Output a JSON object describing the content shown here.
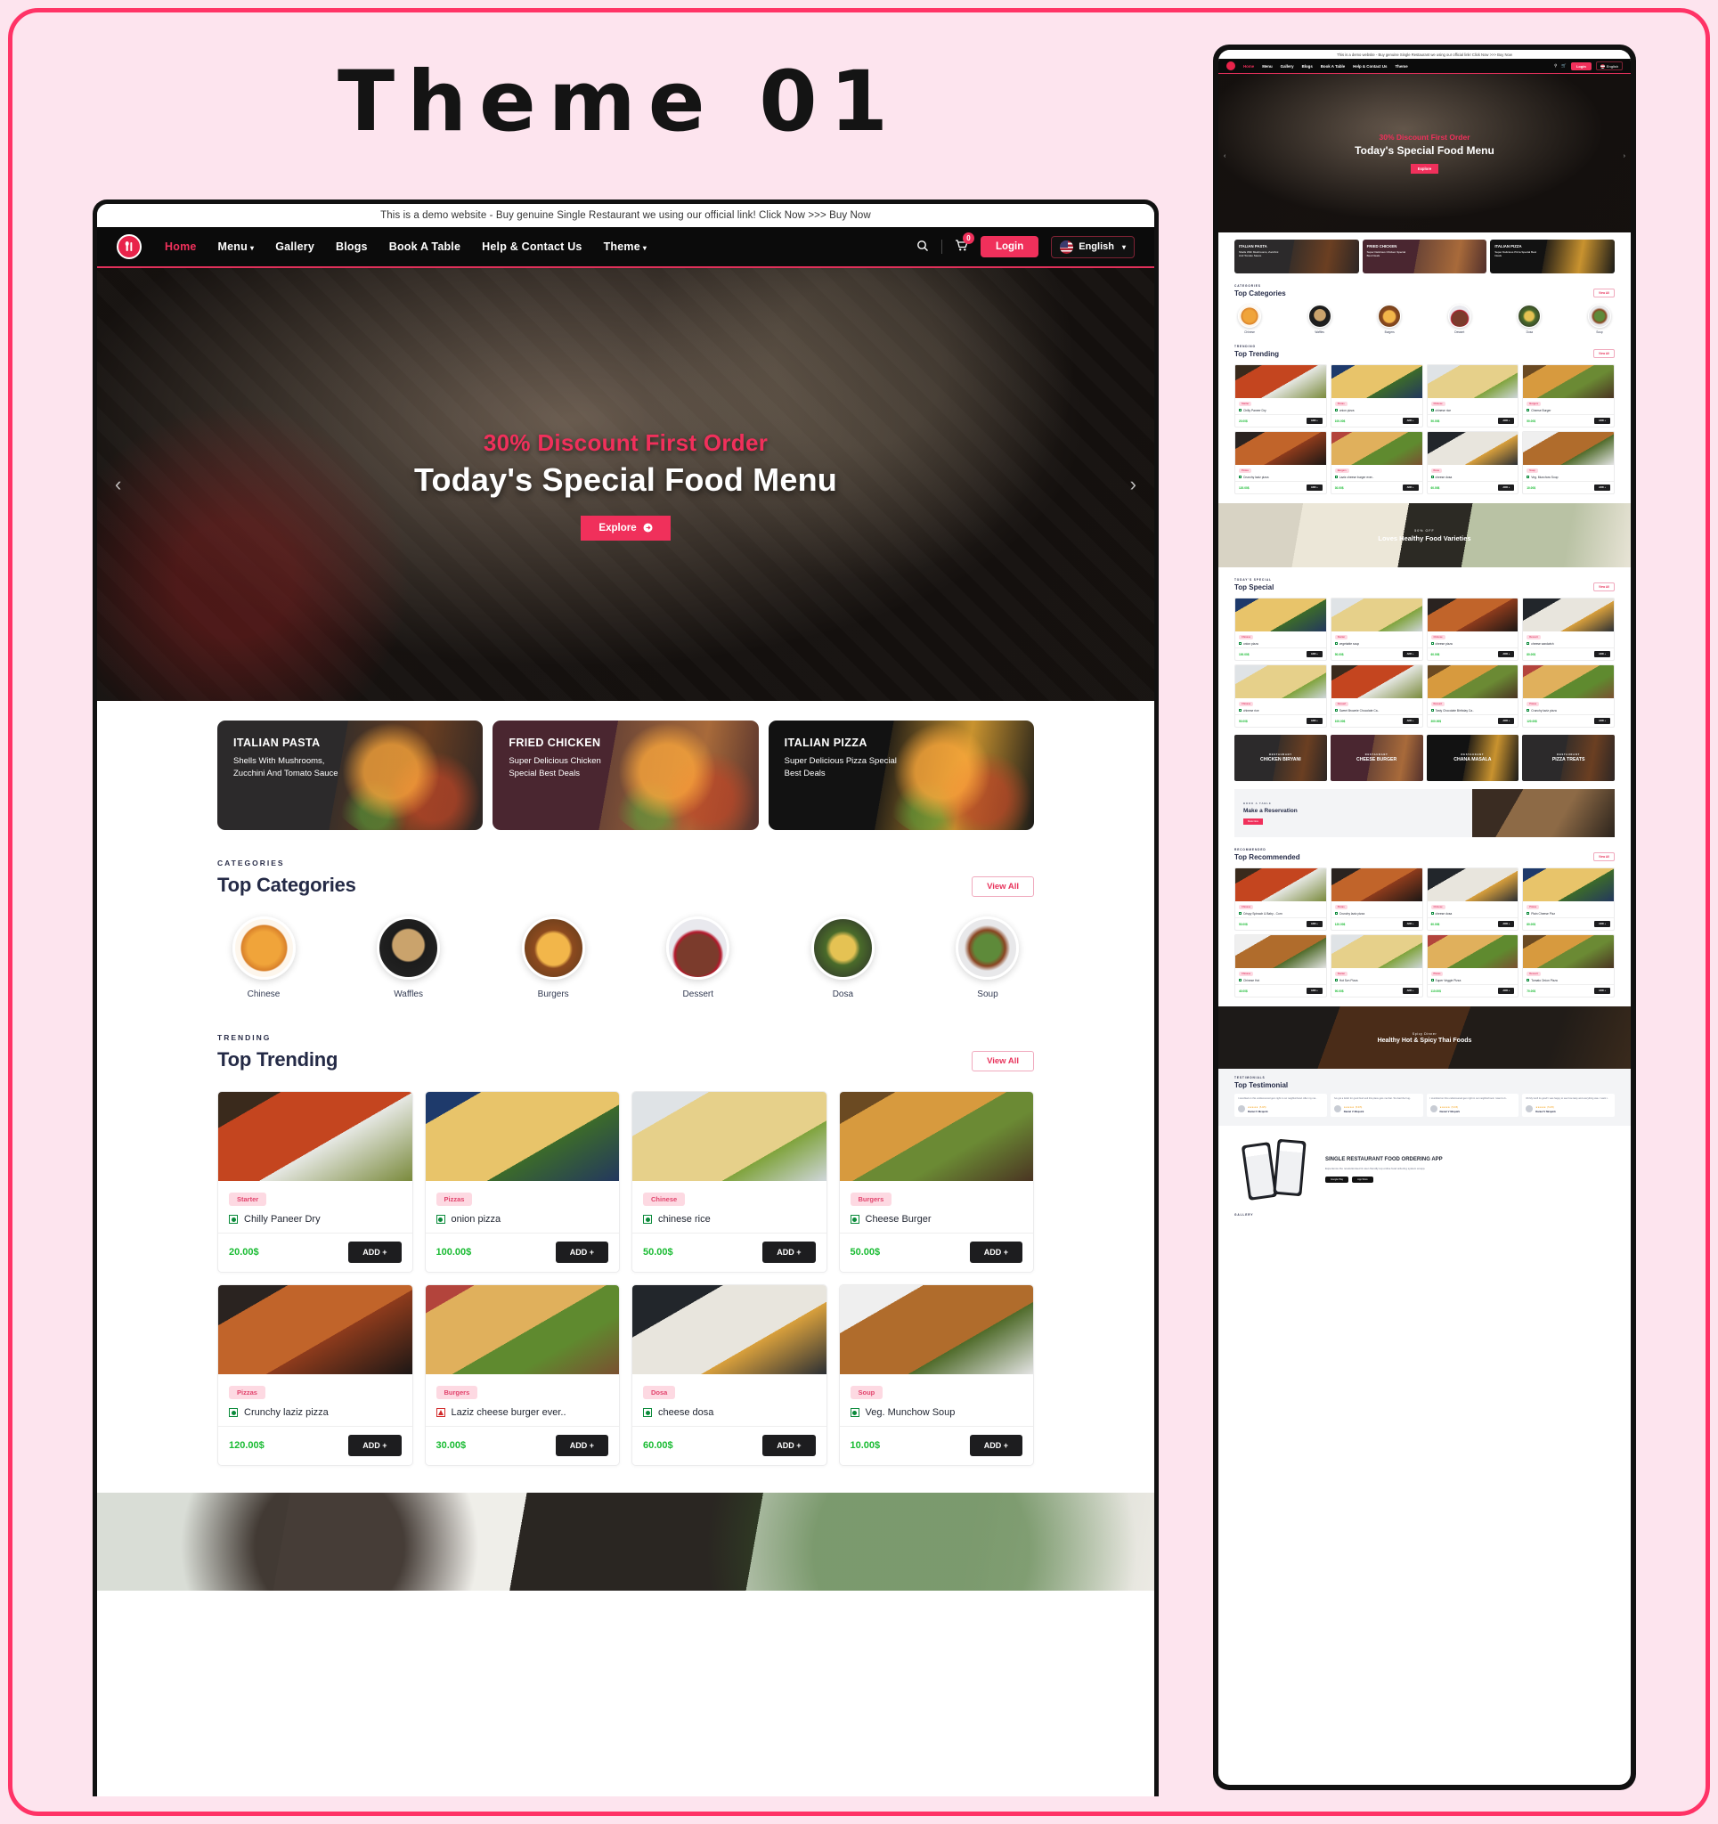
{
  "poster": {
    "title": "Theme 01"
  },
  "site": {
    "demo_notice": "This is a demo website - Buy genuine Single Restaurant we using our official link! Click Now >>> Buy Now",
    "logo_icon": "spoon-fork-icon",
    "nav": [
      {
        "label": "Home",
        "active": true,
        "caret": false
      },
      {
        "label": "Menu",
        "active": false,
        "caret": true
      },
      {
        "label": "Gallery",
        "active": false,
        "caret": false
      },
      {
        "label": "Blogs",
        "active": false,
        "caret": false
      },
      {
        "label": "Book A Table",
        "active": false,
        "caret": false
      },
      {
        "label": "Help & Contact Us",
        "active": false,
        "caret": false
      },
      {
        "label": "Theme",
        "active": false,
        "caret": true
      }
    ],
    "search_icon": "search-icon",
    "cart_icon": "cart-icon",
    "cart_count": "0",
    "login_label": "Login",
    "language_label": "English",
    "caret_glyph": "▾"
  },
  "hero": {
    "kicker": "30% Discount First Order",
    "title": "Today's Special Food Menu",
    "cta": "Explore",
    "cta_icon": "arrow-right-circle-icon",
    "prev_icon": "chevron-left-icon",
    "next_icon": "chevron-right-icon",
    "prev_glyph": "‹",
    "next_glyph": "›"
  },
  "promos": [
    {
      "title": "ITALIAN PASTA",
      "subtitle": "Shells With Mushrooms, Zucchini And Tomato Sauce"
    },
    {
      "title": "FRIED CHICKEN",
      "subtitle": "Super Delicious Chicken Special Best Deals"
    },
    {
      "title": "ITALIAN PIZZA",
      "subtitle": "Super Delicious Pizza Special Best Deals"
    }
  ],
  "categories_section": {
    "kicker": "CATEGORIES",
    "title": "Top Categories",
    "view_all": "View All",
    "items": [
      {
        "label": "Chinese"
      },
      {
        "label": "Waffles"
      },
      {
        "label": "Burgers"
      },
      {
        "label": "Dessert"
      },
      {
        "label": "Dosa"
      },
      {
        "label": "Soup"
      }
    ]
  },
  "trending_section": {
    "kicker": "TRENDING",
    "title": "Top Trending",
    "view_all": "View All",
    "add_label": "ADD +",
    "items": [
      {
        "tag": "Starter",
        "name": "Chilly Paneer Dry",
        "price": "20.00$",
        "veg": true
      },
      {
        "tag": "Pizzas",
        "name": "onion pizza",
        "price": "100.00$",
        "veg": true
      },
      {
        "tag": "Chinese",
        "name": "chinese rice",
        "price": "50.00$",
        "veg": true
      },
      {
        "tag": "Burgers",
        "name": "Cheese Burger",
        "price": "50.00$",
        "veg": true
      },
      {
        "tag": "Pizzas",
        "name": "Crunchy laziz pizza",
        "price": "120.00$",
        "veg": true
      },
      {
        "tag": "Burgers",
        "name": "Laziz cheese burger ever..",
        "price": "30.00$",
        "veg": false
      },
      {
        "tag": "Dosa",
        "name": "cheese dosa",
        "price": "60.00$",
        "veg": true
      },
      {
        "tag": "Soup",
        "name": "Veg. Munchow Soup",
        "price": "10.00$",
        "veg": true
      }
    ]
  },
  "preview": {
    "healthy_banner": {
      "kicker": "50% OFF",
      "title": "Loves Healthy Food Varieties"
    },
    "special_section": {
      "kicker": "TODAY'S SPECIAL",
      "title": "Top Special",
      "view_all": "View All"
    },
    "special_items": [
      {
        "tag": "Chinese",
        "name": "onion pizza",
        "price": "100.00$"
      },
      {
        "tag": "Starter",
        "name": "vegetable soup",
        "price": "50.00$"
      },
      {
        "tag": "Chinese",
        "name": "cheese pizza",
        "price": "60.00$"
      },
      {
        "tag": "Dessert",
        "name": "cheese sandwich",
        "price": "80.00$"
      },
      {
        "tag": "Chinese",
        "name": "chinese rice",
        "price": "50.00$"
      },
      {
        "tag": "Dessert",
        "name": "Sweet Brownie Chocolate Ca..",
        "price": "100.00$"
      },
      {
        "tag": "Dessert",
        "name": "Tasty Chocolate Birthday Ca..",
        "price": "300.00$"
      },
      {
        "tag": "Pizzas",
        "name": "Crunchy laziz pizza",
        "price": "120.00$"
      }
    ],
    "tiles": [
      {
        "kicker": "RESTAURANT",
        "name": "CHICKEN BIRYANI"
      },
      {
        "kicker": "RESTAURANT",
        "name": "CHEESE BURGER"
      },
      {
        "kicker": "RESTAURANT",
        "name": "CHANA MASALA"
      },
      {
        "kicker": "RESTAURANT",
        "name": "PIZZA TREATS"
      }
    ],
    "reservation": {
      "kicker": "BOOK A TABLE",
      "title": "Make a Reservation",
      "button": "Book Now"
    },
    "recommended_section": {
      "kicker": "RECOMMENDED",
      "title": "Top Recommended",
      "view_all": "View All"
    },
    "recommended_items": [
      {
        "tag": "Chinese",
        "name": "Crispy Spinach & Baby - Corn",
        "price": "50.00$"
      },
      {
        "tag": "Pizzas",
        "name": "Crunchy laziz pizza",
        "price": "120.00$"
      },
      {
        "tag": "Chinese",
        "name": "cheese dosa",
        "price": "60.00$"
      },
      {
        "tag": "Pizzas",
        "name": "Plain Cheese Pizz",
        "price": "80.00$"
      },
      {
        "tag": "Chinese",
        "name": "Chinese Hot",
        "price": "40.00$"
      },
      {
        "tag": "Starter",
        "name": "Hot Szn Pizza",
        "price": "90.00$"
      },
      {
        "tag": "Pizzas",
        "name": "Super Veggie Pizza",
        "price": "110.00$"
      },
      {
        "tag": "Dessert",
        "name": "Tomato Onion Pizza",
        "price": "70.00$"
      }
    ],
    "spicy_banner": {
      "kicker": "Spicy Dinner",
      "title": "Healthy Hot & Spicy Thai Foods"
    },
    "testimonial_section": {
      "kicker": "TESTIMONIALS",
      "title": "Top Testimonial"
    },
    "testimonials": [
      {
        "quote": "I stumbled on this undiscovered gem right in our neighborhood. After my ma..",
        "stars": "★★★★★",
        "rating": "(5.0/5)",
        "name": "Daniel V Mcquirk"
      },
      {
        "quote": "I've got a fetish for good food and this place gets me that. Too bad the hug..",
        "stars": "★★★★★",
        "rating": "(5.0/5)",
        "name": "Daniel V Mcquirk"
      },
      {
        "quote": "I stumbled on this undiscovered gem right in our neighborhood. I want to b..",
        "stars": "★★★★★",
        "rating": "(5.0/5)",
        "name": "Daniel V Mcquirk"
      },
      {
        "quote": "Oh My God! its good! i was happy to see how tasty and everything was. I want t..",
        "stars": "★★★★★",
        "rating": "(5.0/5)",
        "name": "Daniel V Mcquirk"
      }
    ],
    "app": {
      "title": "SINGLE RESTAURANT FOOD ORDERING APP",
      "subtitle": "Experience the revolutionised & user-friendly top online food ordering system at app.",
      "badges": [
        "Google Play",
        "App Store"
      ]
    },
    "gallery_kicker": "GALLERY"
  },
  "colors": {
    "accent": "#f0305b",
    "dark": "#0b0b0b",
    "price_green": "#19bb32",
    "page_bg": "#fde4ee",
    "heading": "#242a46"
  }
}
